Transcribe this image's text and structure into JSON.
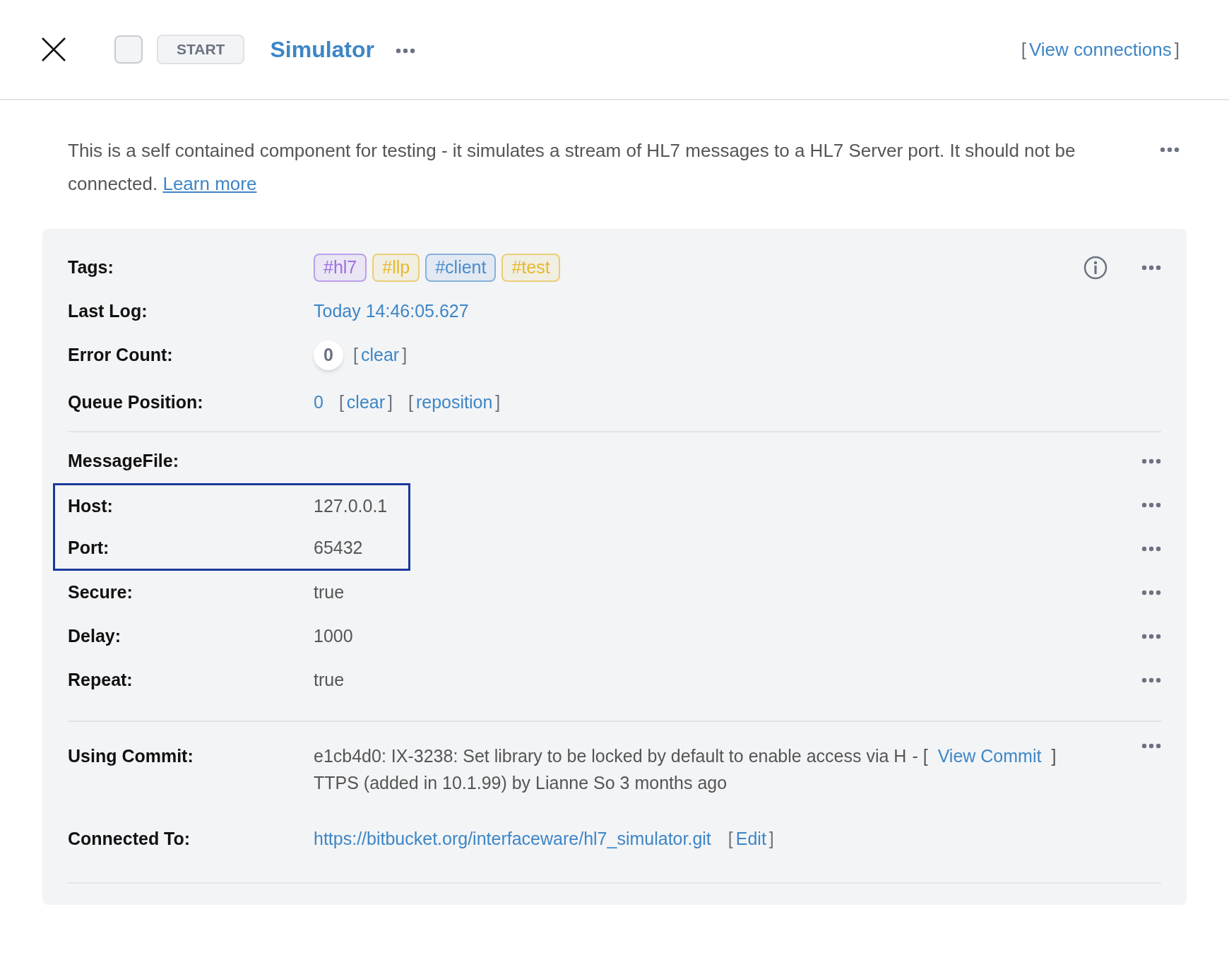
{
  "header": {
    "checkbox": {
      "checked": false
    },
    "start_button": "START",
    "title": "Simulator",
    "view_connections": {
      "open": "[",
      "label": "View connections",
      "close": "]"
    }
  },
  "description": {
    "text": "This is a self contained component for testing - it simulates a stream of HL7 messages to a HL7 Server port. It should not be connected.",
    "link": "Learn more"
  },
  "status": {
    "tags_label": "Tags:",
    "tags": [
      {
        "label": "#hl7",
        "color": "#9b6fe0"
      },
      {
        "label": "#llp",
        "color": "#e6b92e"
      },
      {
        "label": "#client",
        "color": "#4a8ccb"
      },
      {
        "label": "#test",
        "color": "#e6b92e"
      }
    ],
    "last_log_label": "Last Log:",
    "last_log": "Today 14:46:05.627",
    "error_count_label": "Error Count:",
    "error_count": "0",
    "error_clear": {
      "open": "[",
      "label": "clear",
      "close": "]"
    },
    "queue_label": "Queue Position:",
    "queue_value": "0",
    "queue_links": [
      {
        "open": "[",
        "label": "clear",
        "close": "]"
      },
      {
        "open": "[",
        "label": "reposition",
        "close": "]"
      }
    ]
  },
  "config": {
    "heading": "MessageFile:",
    "rows": [
      {
        "label": "Host:",
        "value": "127.0.0.1",
        "selected": true
      },
      {
        "label": "Port:",
        "value": "65432",
        "selected": true
      },
      {
        "label": "Secure:",
        "value": "true",
        "selected": false
      },
      {
        "label": "Delay:",
        "value": "1000",
        "selected": false
      },
      {
        "label": "Repeat:",
        "value": "true",
        "selected": false
      }
    ]
  },
  "source": {
    "commit_label": "Using Commit:",
    "commit_lines": [
      "e1cb4d0: IX-3238: Set library to be locked by default to enable access via H",
      "TTPS (added in 10.1.99) by Lianne So 3 months ago"
    ],
    "commit_sep": "- [",
    "commit_link": "View Commit",
    "commit_close": "]",
    "connected_label": "Connected To:",
    "connected_url": "https://bitbucket.org/interfaceware/hl7_simulator.git",
    "edit": {
      "open": "[",
      "label": "Edit",
      "close": "]"
    }
  }
}
